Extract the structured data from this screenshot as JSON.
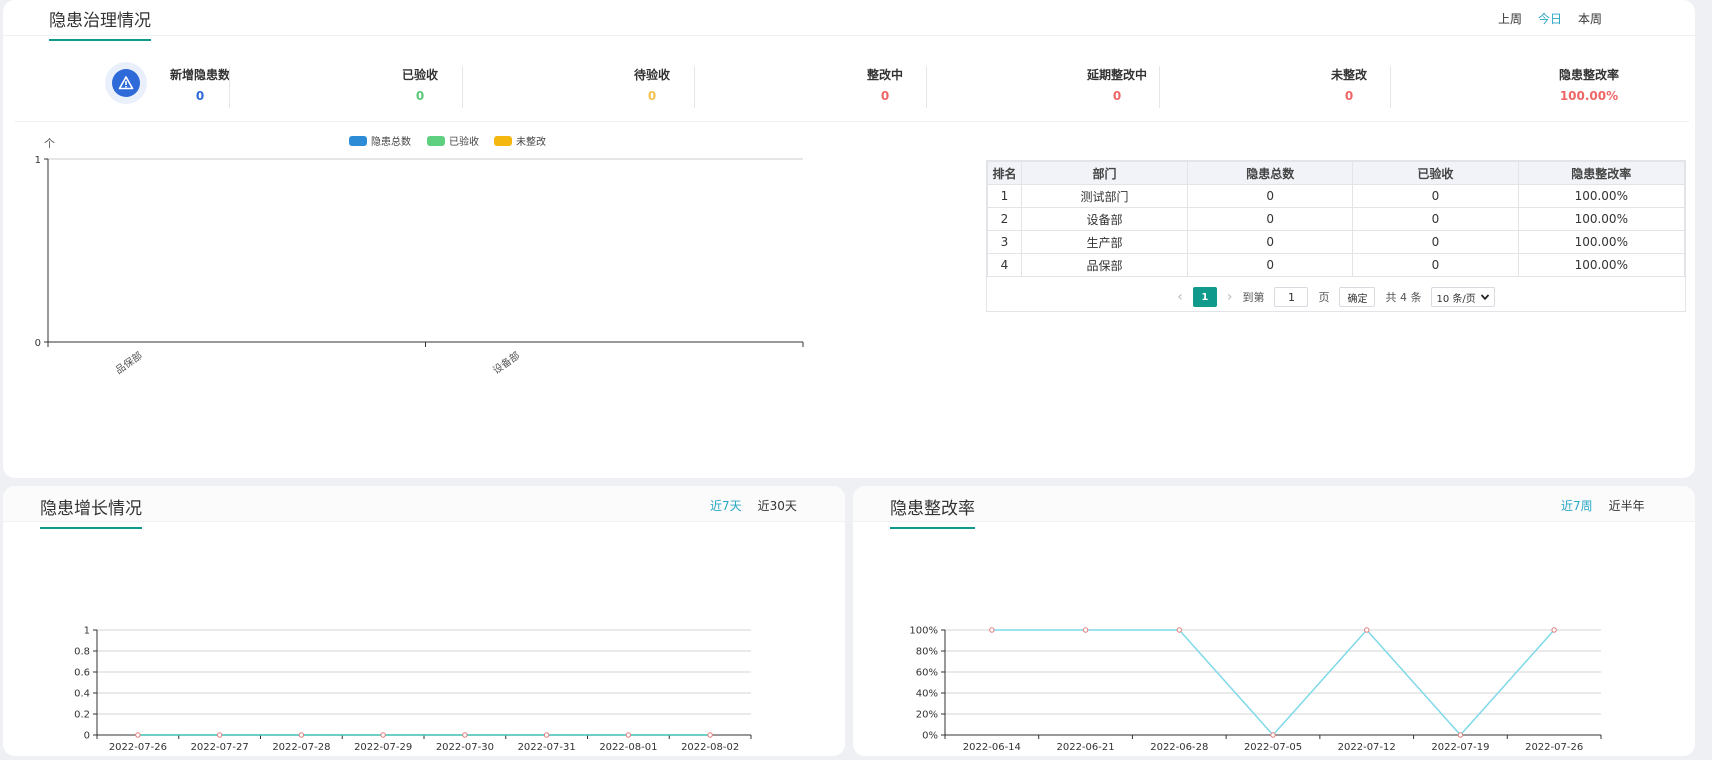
{
  "governance": {
    "title": "隐患治理情况",
    "tabs": [
      {
        "label": "上周",
        "active": false
      },
      {
        "label": "今日",
        "active": true
      },
      {
        "label": "本周",
        "active": false
      }
    ],
    "stats_icon": "warning-triangle-icon",
    "stats": [
      {
        "label": "新增隐患数",
        "value": "0",
        "color": "#2e6ad8"
      },
      {
        "label": "已验收",
        "value": "0",
        "color": "#5cc97a"
      },
      {
        "label": "待验收",
        "value": "0",
        "color": "#f2c14e"
      },
      {
        "label": "整改中",
        "value": "0",
        "color": "#ee6666"
      },
      {
        "label": "延期整改中",
        "value": "0",
        "color": "#ee6666"
      },
      {
        "label": "未整改",
        "value": "0",
        "color": "#ee6666"
      },
      {
        "label": "隐患整改率",
        "value": "100.00%",
        "color": "#ee6666"
      }
    ],
    "table": {
      "headers": [
        "排名",
        "部门",
        "隐患总数",
        "已验收",
        "隐患整改率"
      ],
      "rows": [
        [
          "1",
          "测试部门",
          "0",
          "0",
          "100.00%"
        ],
        [
          "2",
          "设备部",
          "0",
          "0",
          "100.00%"
        ],
        [
          "3",
          "生产部",
          "0",
          "0",
          "100.00%"
        ],
        [
          "4",
          "品保部",
          "0",
          "0",
          "100.00%"
        ]
      ]
    },
    "pager": {
      "current_page": "1",
      "goto_label": "到第",
      "goto_value": "1",
      "page_unit": "页",
      "confirm_label": "确定",
      "total_label": "共 4 条",
      "page_size_label": "10 条/页"
    }
  },
  "growth": {
    "title": "隐患增长情况",
    "tabs": [
      {
        "label": "近7天",
        "active": true
      },
      {
        "label": "近30天",
        "active": false
      }
    ]
  },
  "rate": {
    "title": "隐患整改率",
    "tabs": [
      {
        "label": "近7周",
        "active": true
      },
      {
        "label": "近半年",
        "active": false
      }
    ]
  },
  "chart_data": [
    {
      "id": "dept-bar",
      "type": "bar",
      "y_axis_symbol": "个",
      "categories": [
        "品保部",
        "设备部"
      ],
      "series": [
        {
          "name": "隐患总数",
          "values": [
            0,
            0
          ],
          "color": "#2d8cd6"
        },
        {
          "name": "已验收",
          "values": [
            0,
            0
          ],
          "color": "#5ed07f"
        },
        {
          "name": "未整改",
          "values": [
            0,
            0
          ],
          "color": "#f4b70f"
        }
      ],
      "ylim": [
        0,
        1
      ],
      "yticks": [
        "0",
        "1"
      ],
      "legend": "top-center",
      "grid": true
    },
    {
      "id": "growth-line",
      "type": "line",
      "x": [
        "2022-07-26",
        "2022-07-27",
        "2022-07-28",
        "2022-07-29",
        "2022-07-30",
        "2022-07-31",
        "2022-08-01",
        "2022-08-02"
      ],
      "values": [
        0,
        0,
        0,
        0,
        0,
        0,
        0,
        0
      ],
      "ylim": [
        0,
        1
      ],
      "yticks": [
        "0",
        "0.2",
        "0.4",
        "0.6",
        "0.8",
        "1"
      ],
      "line_color": "#3fc1b0",
      "point_color": "#e07a7a",
      "grid": true
    },
    {
      "id": "rate-line",
      "type": "line",
      "x": [
        "2022-06-14",
        "2022-06-21",
        "2022-06-28",
        "2022-07-05",
        "2022-07-12",
        "2022-07-19",
        "2022-07-26"
      ],
      "values": [
        100,
        100,
        100,
        0,
        100,
        0,
        100
      ],
      "ylim": [
        0,
        100
      ],
      "yticks": [
        "0%",
        "20%",
        "40%",
        "60%",
        "80%",
        "100%"
      ],
      "line_color": "#7fd8e8",
      "point_color": "#e07a7a",
      "grid": true
    }
  ]
}
